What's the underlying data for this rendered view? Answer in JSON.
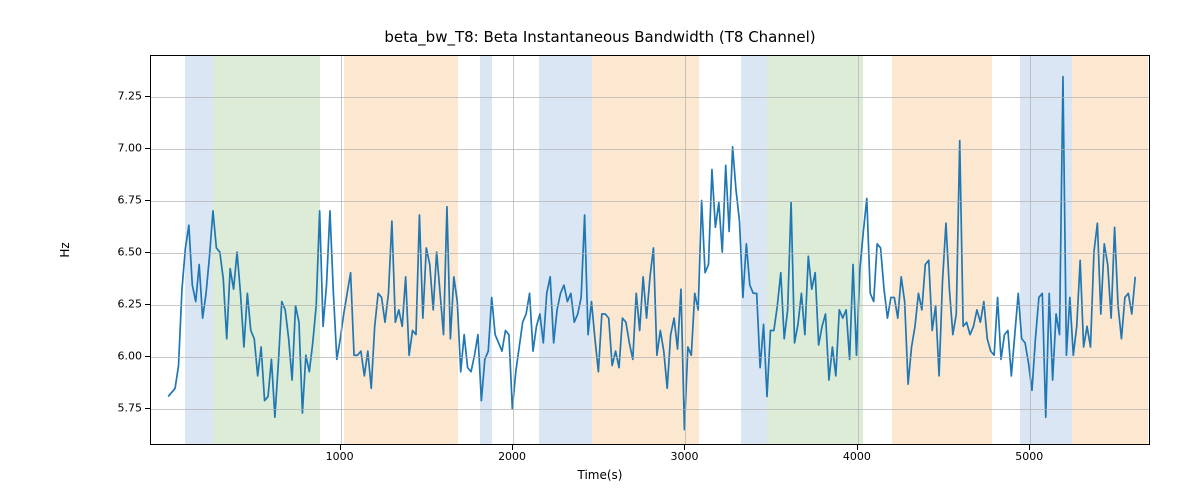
{
  "chart_data": {
    "type": "line",
    "title": "beta_bw_T8: Beta Instantaneous Bandwidth (T8 Channel)",
    "xlabel": "Time(s)",
    "ylabel": "Hz",
    "xlim": [
      -100,
      5700
    ],
    "ylim": [
      5.57,
      7.45
    ],
    "xticks": [
      1000,
      2000,
      3000,
      4000,
      5000
    ],
    "yticks": [
      5.75,
      6.0,
      6.25,
      6.5,
      6.75,
      7.0,
      7.25
    ],
    "bands": [
      {
        "start": 100,
        "end": 260,
        "color": "blue"
      },
      {
        "start": 260,
        "end": 880,
        "color": "green"
      },
      {
        "start": 1020,
        "end": 1680,
        "color": "orng"
      },
      {
        "start": 1810,
        "end": 1880,
        "color": "blue"
      },
      {
        "start": 2150,
        "end": 2460,
        "color": "blue"
      },
      {
        "start": 2460,
        "end": 3080,
        "color": "orng"
      },
      {
        "start": 3320,
        "end": 3470,
        "color": "blue"
      },
      {
        "start": 3470,
        "end": 4030,
        "color": "green"
      },
      {
        "start": 4200,
        "end": 4780,
        "color": "orng"
      },
      {
        "start": 4940,
        "end": 5240,
        "color": "blue"
      },
      {
        "start": 5240,
        "end": 5680,
        "color": "orng"
      }
    ],
    "series": [
      {
        "name": "beta_bw_T8",
        "color": "#1f77b4",
        "x_start": 0,
        "x_step": 20,
        "values": [
          5.8,
          5.82,
          5.84,
          5.95,
          6.32,
          6.52,
          6.63,
          6.34,
          6.26,
          6.44,
          6.18,
          6.3,
          6.48,
          6.7,
          6.52,
          6.5,
          6.37,
          6.08,
          6.42,
          6.32,
          6.5,
          6.3,
          6.04,
          6.3,
          6.12,
          6.08,
          5.9,
          6.04,
          5.78,
          5.8,
          5.98,
          5.7,
          5.96,
          6.26,
          6.22,
          6.08,
          5.88,
          6.24,
          6.16,
          5.72,
          6.0,
          5.92,
          6.06,
          6.24,
          6.7,
          6.14,
          6.34,
          6.7,
          6.3,
          5.98,
          6.08,
          6.2,
          6.3,
          6.4,
          6.0,
          6.0,
          6.02,
          5.9,
          6.02,
          5.84,
          6.14,
          6.3,
          6.28,
          6.16,
          6.3,
          6.65,
          6.16,
          6.22,
          6.14,
          6.38,
          6.0,
          6.12,
          6.1,
          6.68,
          6.18,
          6.52,
          6.44,
          6.22,
          6.5,
          6.3,
          6.1,
          6.72,
          6.08,
          6.38,
          6.26,
          5.92,
          6.1,
          5.94,
          5.92,
          6.0,
          6.1,
          5.78,
          5.98,
          6.02,
          6.28,
          6.1,
          6.06,
          6.02,
          6.12,
          6.1,
          5.74,
          5.92,
          6.04,
          6.16,
          6.2,
          6.3,
          6.02,
          6.14,
          6.2,
          6.06,
          6.3,
          6.38,
          6.06,
          6.22,
          6.3,
          6.34,
          6.26,
          6.3,
          6.16,
          6.2,
          6.28,
          6.68,
          6.1,
          6.26,
          6.08,
          5.92,
          6.2,
          6.2,
          6.18,
          5.95,
          6.02,
          5.94,
          6.18,
          6.16,
          6.06,
          5.98,
          6.3,
          6.12,
          6.38,
          6.18,
          6.38,
          6.52,
          6.0,
          6.12,
          6.02,
          5.84,
          6.1,
          6.18,
          6.03,
          6.32,
          5.64,
          6.04,
          6.0,
          6.3,
          6.22,
          6.75,
          6.4,
          6.44,
          6.9,
          6.62,
          6.74,
          6.5,
          6.92,
          6.6,
          7.01,
          6.8,
          6.65,
          6.28,
          6.54,
          6.34,
          6.3,
          6.3,
          5.94,
          6.15,
          5.8,
          6.12,
          6.12,
          6.24,
          6.4,
          6.08,
          6.22,
          6.74,
          6.06,
          6.15,
          6.3,
          6.1,
          6.48,
          6.32,
          6.4,
          6.05,
          6.14,
          6.2,
          5.88,
          6.04,
          5.9,
          6.22,
          6.18,
          6.22,
          5.98,
          6.44,
          6.0,
          6.42,
          6.6,
          6.76,
          6.3,
          6.26,
          6.54,
          6.52,
          6.32,
          6.18,
          6.28,
          6.28,
          6.18,
          6.38,
          6.26,
          5.86,
          6.04,
          6.14,
          6.3,
          6.22,
          6.44,
          6.46,
          6.12,
          6.24,
          5.9,
          6.36,
          6.64,
          6.32,
          6.1,
          6.2,
          7.04,
          6.14,
          6.16,
          6.1,
          6.14,
          6.22,
          6.16,
          6.26,
          6.08,
          6.02,
          6.0,
          6.28,
          5.98,
          6.1,
          6.12,
          5.9,
          6.1,
          6.3,
          6.08,
          6.06,
          5.96,
          5.83,
          6.08,
          6.28,
          6.3,
          5.7,
          6.3,
          5.88,
          6.2,
          6.1,
          7.35,
          6.0,
          6.28,
          6.0,
          6.14,
          6.46,
          6.04,
          6.14,
          6.04,
          6.5,
          6.64,
          6.2,
          6.54,
          6.44,
          6.18,
          6.62,
          6.24,
          6.08,
          6.28,
          6.3,
          6.2,
          6.38
        ]
      }
    ]
  }
}
